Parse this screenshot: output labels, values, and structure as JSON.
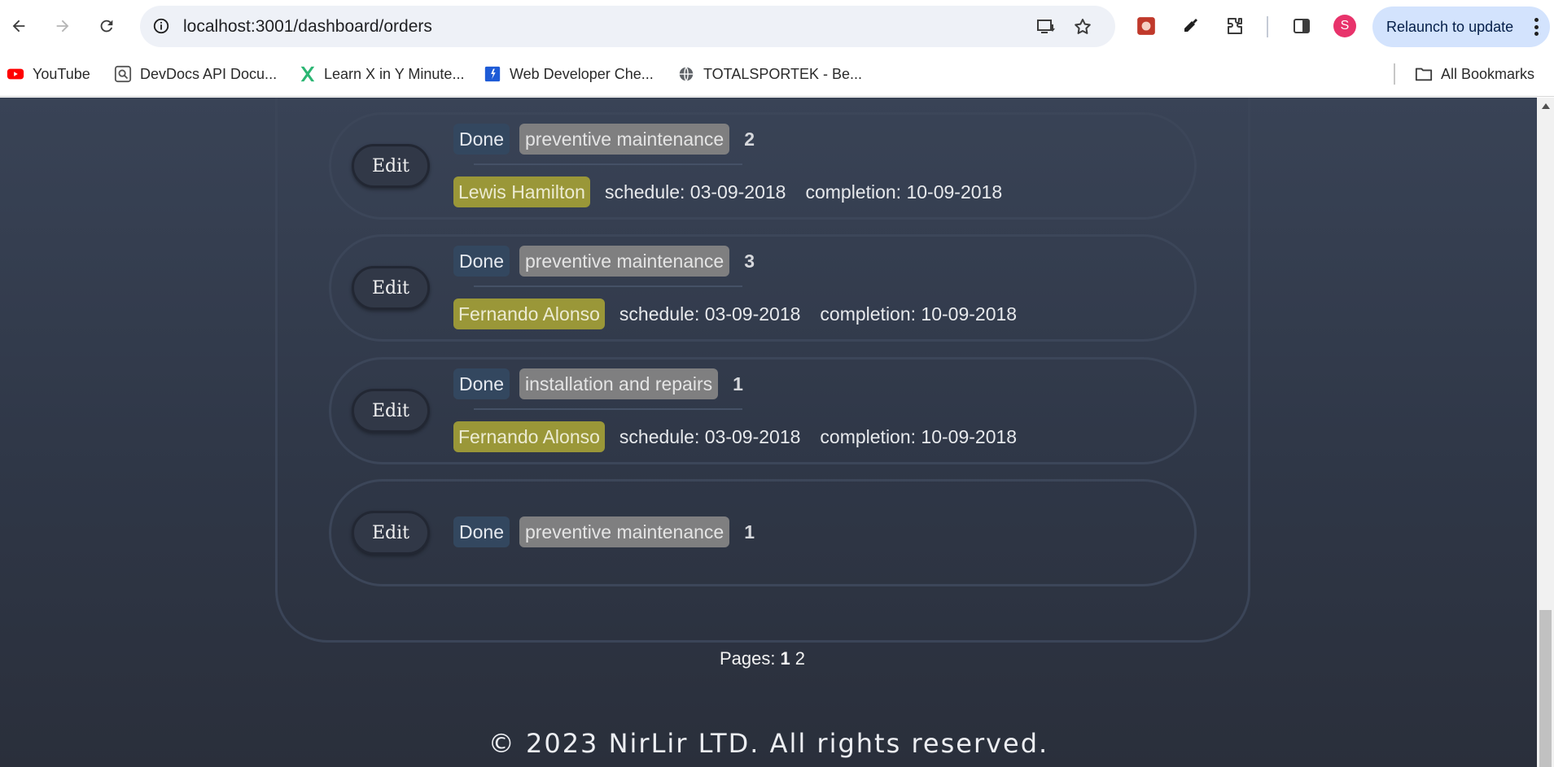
{
  "browser": {
    "url": "localhost:3001/dashboard/orders",
    "relaunch_label": "Relaunch to update",
    "profile_initial": "S",
    "bookmarks": [
      {
        "label": "YouTube",
        "icon": "youtube-icon"
      },
      {
        "label": "DevDocs API Docu...",
        "icon": "devdocs-icon"
      },
      {
        "label": "Learn X in Y Minute...",
        "icon": "learnx-icon"
      },
      {
        "label": "Web Developer Che...",
        "icon": "webdev-icon"
      },
      {
        "label": "TOTALSPORTEK - Be...",
        "icon": "globe-icon"
      }
    ],
    "all_bookmarks_label": "All Bookmarks"
  },
  "orders": [
    {
      "edit_label": "Edit",
      "status": "Done",
      "service": "preventive maintenance",
      "count": "2",
      "driver": "Lewis Hamilton",
      "schedule": "schedule: 03-09-2018",
      "completion": "completion: 10-09-2018"
    },
    {
      "edit_label": "Edit",
      "status": "Done",
      "service": "preventive maintenance",
      "count": "3",
      "driver": "Fernando Alonso",
      "schedule": "schedule: 03-09-2018",
      "completion": "completion: 10-09-2018"
    },
    {
      "edit_label": "Edit",
      "status": "Done",
      "service": "installation and repairs",
      "count": "1",
      "driver": "Fernando Alonso",
      "schedule": "schedule: 03-09-2018",
      "completion": "completion: 10-09-2018"
    },
    {
      "edit_label": "Edit",
      "status": "Done",
      "service": "preventive maintenance",
      "count": "1"
    }
  ],
  "pagination": {
    "label": "Pages:",
    "current": "1",
    "pages": [
      "2"
    ]
  },
  "footer": "© 2023 NirLir LTD. All rights reserved.",
  "colors": {
    "status_badge": "#33475f",
    "service_badge": "#7f7f80",
    "driver_badge": "#9a9738",
    "relaunch_bg": "#d3e3fd",
    "avatar_bg": "#e8336b"
  }
}
